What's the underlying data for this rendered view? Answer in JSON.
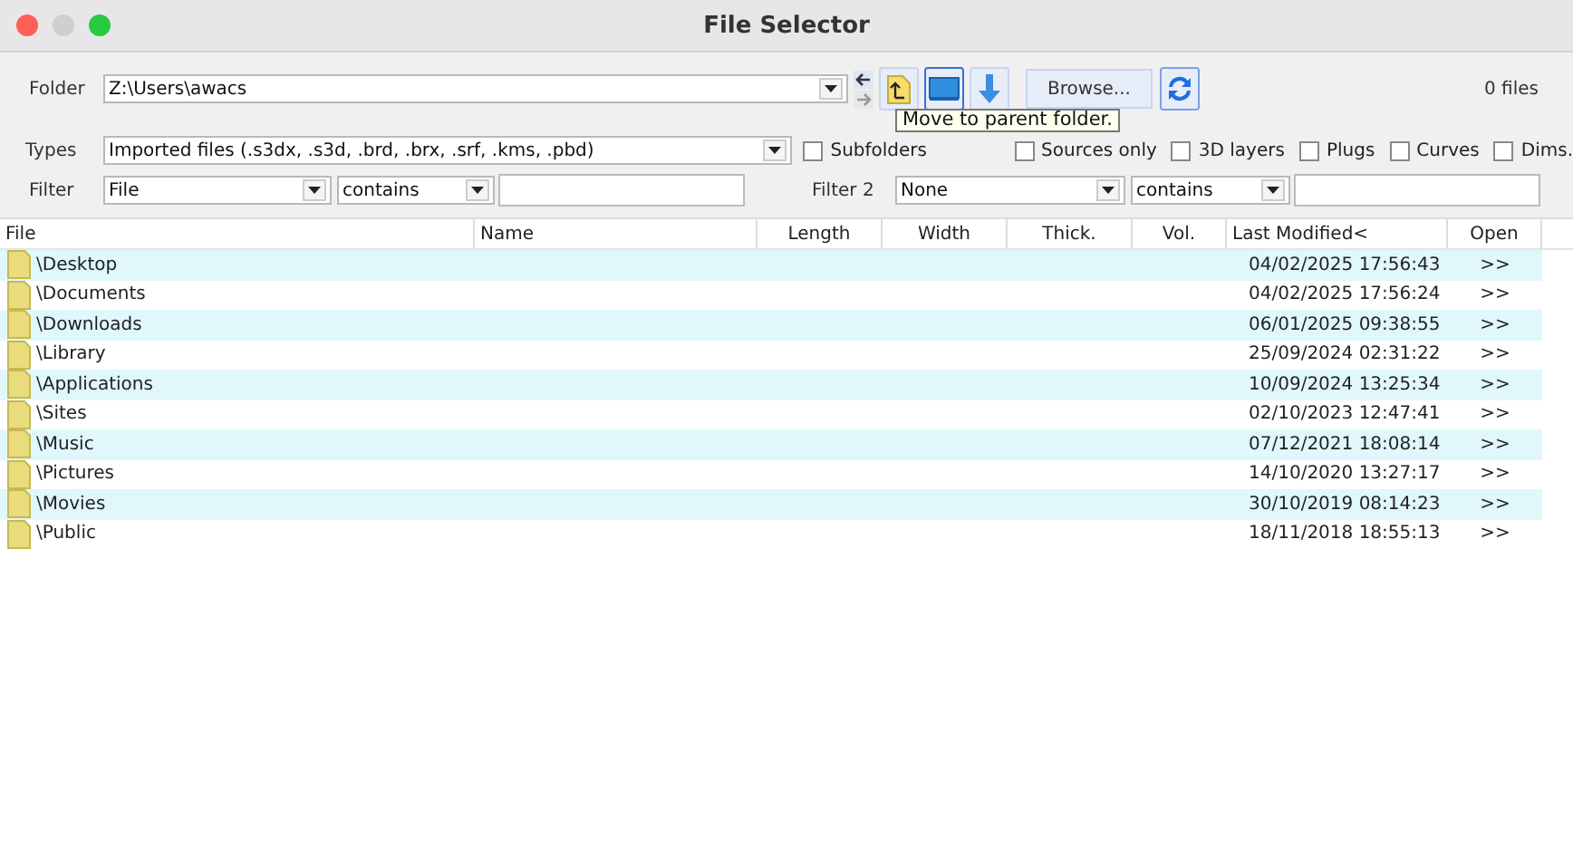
{
  "window": {
    "title": "File Selector"
  },
  "folder": {
    "label": "Folder",
    "value": "Z:\\Users\\awacs"
  },
  "types": {
    "label": "Types",
    "value": "Imported files (.s3dx, .s3d, .brd, .brx, .srf, .kms, .pbd)"
  },
  "filter": {
    "label": "Filter",
    "field": "File",
    "operator": "contains"
  },
  "filter2": {
    "label": "Filter 2",
    "field": "None",
    "operator": "contains"
  },
  "browse_button": "Browse...",
  "file_count": "0 files",
  "tooltip": "Move to parent folder.",
  "options": [
    {
      "label": "Subfolders",
      "checked": false
    },
    {
      "label": "Sources only",
      "checked": false
    },
    {
      "label": "3D layers",
      "checked": false
    },
    {
      "label": "Plugs",
      "checked": false
    },
    {
      "label": "Curves",
      "checked": false
    },
    {
      "label": "Dims.",
      "checked": false
    }
  ],
  "table": {
    "columns": [
      "File",
      "Name",
      "Length",
      "Width",
      "Thick.",
      "Vol.",
      "Last Modified<",
      "Open"
    ],
    "rows": [
      {
        "file": "\\Desktop",
        "last_modified": "04/02/2025 17:56:43",
        "open": ">>"
      },
      {
        "file": "\\Documents",
        "last_modified": "04/02/2025 17:56:24",
        "open": ">>"
      },
      {
        "file": "\\Downloads",
        "last_modified": "06/01/2025 09:38:55",
        "open": ">>"
      },
      {
        "file": "\\Library",
        "last_modified": "25/09/2024 02:31:22",
        "open": ">>"
      },
      {
        "file": "\\Applications",
        "last_modified": "10/09/2024 13:25:34",
        "open": ">>"
      },
      {
        "file": "\\Sites",
        "last_modified": "02/10/2023 12:47:41",
        "open": ">>"
      },
      {
        "file": "\\Music",
        "last_modified": "07/12/2021 18:08:14",
        "open": ">>"
      },
      {
        "file": "\\Pictures",
        "last_modified": "14/10/2020 13:27:17",
        "open": ">>"
      },
      {
        "file": "\\Movies",
        "last_modified": "30/10/2019 08:14:23",
        "open": ">>"
      },
      {
        "file": "\\Public",
        "last_modified": "18/11/2018 18:55:13",
        "open": ">>"
      }
    ]
  }
}
